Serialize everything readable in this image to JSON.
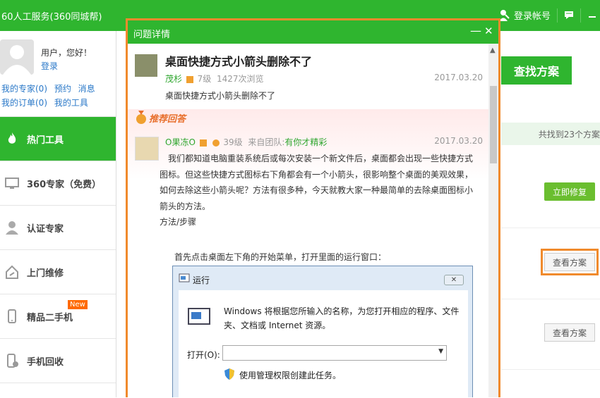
{
  "topbar": {
    "title": "60人工服务(360同城帮)",
    "login": "登录帐号"
  },
  "user": {
    "greeting": "用户，您好！",
    "login": "登录"
  },
  "user_links": {
    "row1": [
      "我的专家(0)",
      "预约",
      "消息"
    ],
    "row2": [
      "我的订单(0)",
      "我的工具"
    ]
  },
  "menu": {
    "items": [
      {
        "label": "热门工具",
        "icon": "fire-icon"
      },
      {
        "label": "360专家（免费）",
        "icon": "monitor-icon"
      },
      {
        "label": "认证专家",
        "icon": "person-icon"
      },
      {
        "label": "上门维修",
        "icon": "home-wrench-icon"
      },
      {
        "label": "精品二手机",
        "icon": "phone-icon",
        "badge": "New"
      },
      {
        "label": "手机回收",
        "icon": "phone-recycle-icon"
      }
    ]
  },
  "right": {
    "find_button": "查找方案",
    "found_text": "共找到23个方案",
    "fix_button": "立即修复",
    "plan_button": "查看方案"
  },
  "dialog": {
    "title": "问题详情",
    "question": {
      "title": "桌面快捷方式小箭头删除不了",
      "user": "茂杉",
      "level": "7级",
      "views": "1427次浏览",
      "date": "2017.03.20",
      "body": "桌面快捷方式小箭头删除不了"
    },
    "recommend_label": "推荐回答",
    "answer": {
      "user": "O果冻O",
      "level": "39级",
      "team_prefix": "来自团队:",
      "team": "有你才精彩",
      "date": "2017.03.20",
      "paragraphs": [
        "我们都知道电脑重装系统后或每次安装一个新文件后，桌面都会出现一些快捷方式图标。但这些快捷方式图标右下角都会有一个小箭头，很影响整个桌面的美观效果，如何去除这些小箭头呢？方法有很多种，今天就教大家一种最简单的去除桌面图标小箭头的方法。",
        "方法/步骤"
      ],
      "step1": "首先点击桌面左下角的开始菜单，打开里面的运行窗口："
    },
    "run_dialog": {
      "title": "运行",
      "description": "Windows 将根据您所输入的名称，为您打开相应的程序、文件夹、文档或 Internet 资源。",
      "open_label": "打开(O):",
      "admin_text": "使用管理权限创建此任务。"
    }
  },
  "colors": {
    "brand_green": "#2fb52f",
    "highlight_orange": "#f08a2c"
  }
}
